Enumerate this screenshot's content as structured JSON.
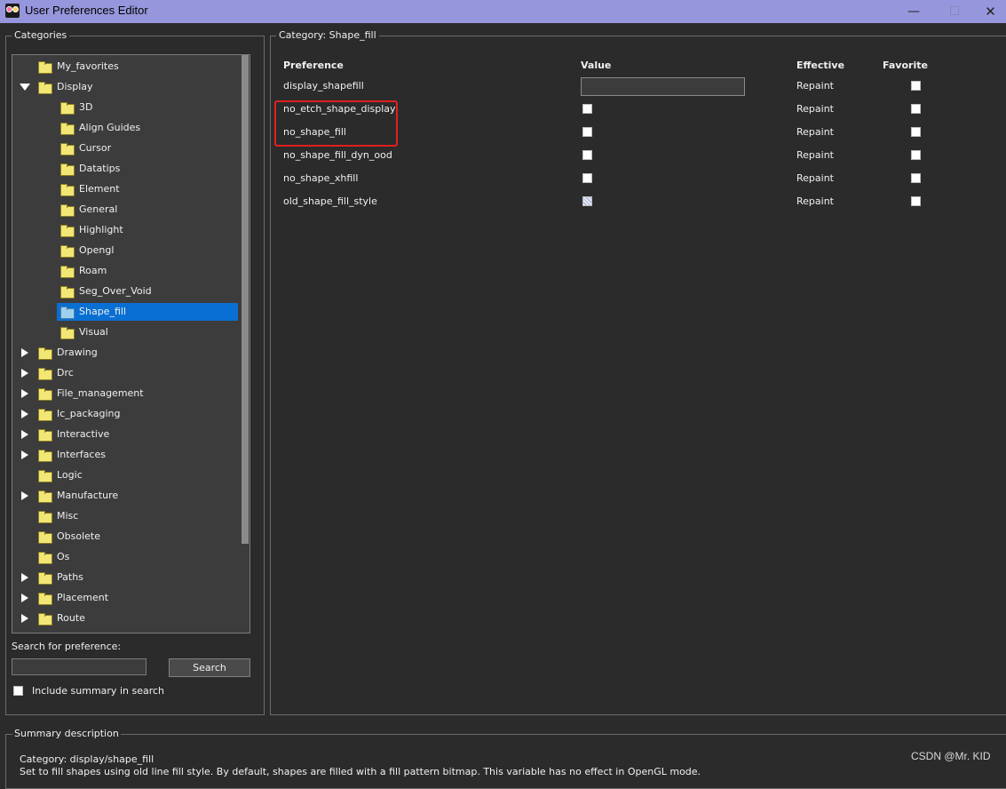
{
  "window": {
    "title": "User Preferences Editor",
    "minimize_glyph": "—",
    "maximize_glyph": "☐",
    "close_glyph": "✕"
  },
  "categories": {
    "title": "Categories",
    "items": [
      {
        "label": "My_favorites",
        "level": 0,
        "expander": "none"
      },
      {
        "label": "Display",
        "level": 0,
        "expander": "open"
      },
      {
        "label": "3D",
        "level": 1,
        "expander": "none"
      },
      {
        "label": "Align Guides",
        "level": 1,
        "expander": "none"
      },
      {
        "label": "Cursor",
        "level": 1,
        "expander": "none"
      },
      {
        "label": "Datatips",
        "level": 1,
        "expander": "none"
      },
      {
        "label": "Element",
        "level": 1,
        "expander": "none"
      },
      {
        "label": "General",
        "level": 1,
        "expander": "none"
      },
      {
        "label": "Highlight",
        "level": 1,
        "expander": "none"
      },
      {
        "label": "Opengl",
        "level": 1,
        "expander": "none"
      },
      {
        "label": "Roam",
        "level": 1,
        "expander": "none"
      },
      {
        "label": "Seg_Over_Void",
        "level": 1,
        "expander": "none"
      },
      {
        "label": "Shape_fill",
        "level": 1,
        "expander": "none",
        "selected": true
      },
      {
        "label": "Visual",
        "level": 1,
        "expander": "none"
      },
      {
        "label": "Drawing",
        "level": 0,
        "expander": "closed"
      },
      {
        "label": "Drc",
        "level": 0,
        "expander": "closed"
      },
      {
        "label": "File_management",
        "level": 0,
        "expander": "closed"
      },
      {
        "label": "Ic_packaging",
        "level": 0,
        "expander": "closed"
      },
      {
        "label": "Interactive",
        "level": 0,
        "expander": "closed"
      },
      {
        "label": "Interfaces",
        "level": 0,
        "expander": "closed"
      },
      {
        "label": "Logic",
        "level": 0,
        "expander": "none"
      },
      {
        "label": "Manufacture",
        "level": 0,
        "expander": "closed"
      },
      {
        "label": "Misc",
        "level": 0,
        "expander": "none"
      },
      {
        "label": "Obsolete",
        "level": 0,
        "expander": "none"
      },
      {
        "label": "Os",
        "level": 0,
        "expander": "none"
      },
      {
        "label": "Paths",
        "level": 0,
        "expander": "closed"
      },
      {
        "label": "Placement",
        "level": 0,
        "expander": "closed"
      },
      {
        "label": "Route",
        "level": 0,
        "expander": "closed"
      }
    ]
  },
  "search": {
    "label": "Search for preference:",
    "value": "",
    "button_label": "Search",
    "include_summary_label": "Include summary in search",
    "include_summary_checked": false
  },
  "category_panel": {
    "caption": "Category:  Shape_fill",
    "headers": {
      "preference": "Preference",
      "value": "Value",
      "effective": "Effective",
      "favorite": "Favorite"
    },
    "rows": [
      {
        "name": "display_shapefill",
        "value_type": "text",
        "value": "",
        "effective": "Repaint"
      },
      {
        "name": "no_etch_shape_display",
        "value_type": "checkbox",
        "value": "unchecked",
        "effective": "Repaint"
      },
      {
        "name": "no_shape_fill",
        "value_type": "checkbox",
        "value": "unchecked",
        "effective": "Repaint"
      },
      {
        "name": "no_shape_fill_dyn_ood",
        "value_type": "checkbox",
        "value": "unchecked",
        "effective": "Repaint"
      },
      {
        "name": "no_shape_xhfill",
        "value_type": "checkbox",
        "value": "unchecked",
        "effective": "Repaint"
      },
      {
        "name": "old_shape_fill_style",
        "value_type": "checkbox",
        "value": "partial",
        "effective": "Repaint"
      }
    ]
  },
  "summary": {
    "title": "Summary description",
    "category_line": "Category: display/shape_fill",
    "description_line": "Set to fill shapes using old line fill style. By default, shapes are filled with a fill pattern bitmap. This variable has no effect in OpenGL mode."
  },
  "watermark": "CSDN @Mr. KID",
  "colors": {
    "title_bar": "#9696dc",
    "background": "#2b2b2b",
    "selection": "#0a6fd2",
    "highlight_box": "#e02020",
    "folder": "#f2e675"
  }
}
